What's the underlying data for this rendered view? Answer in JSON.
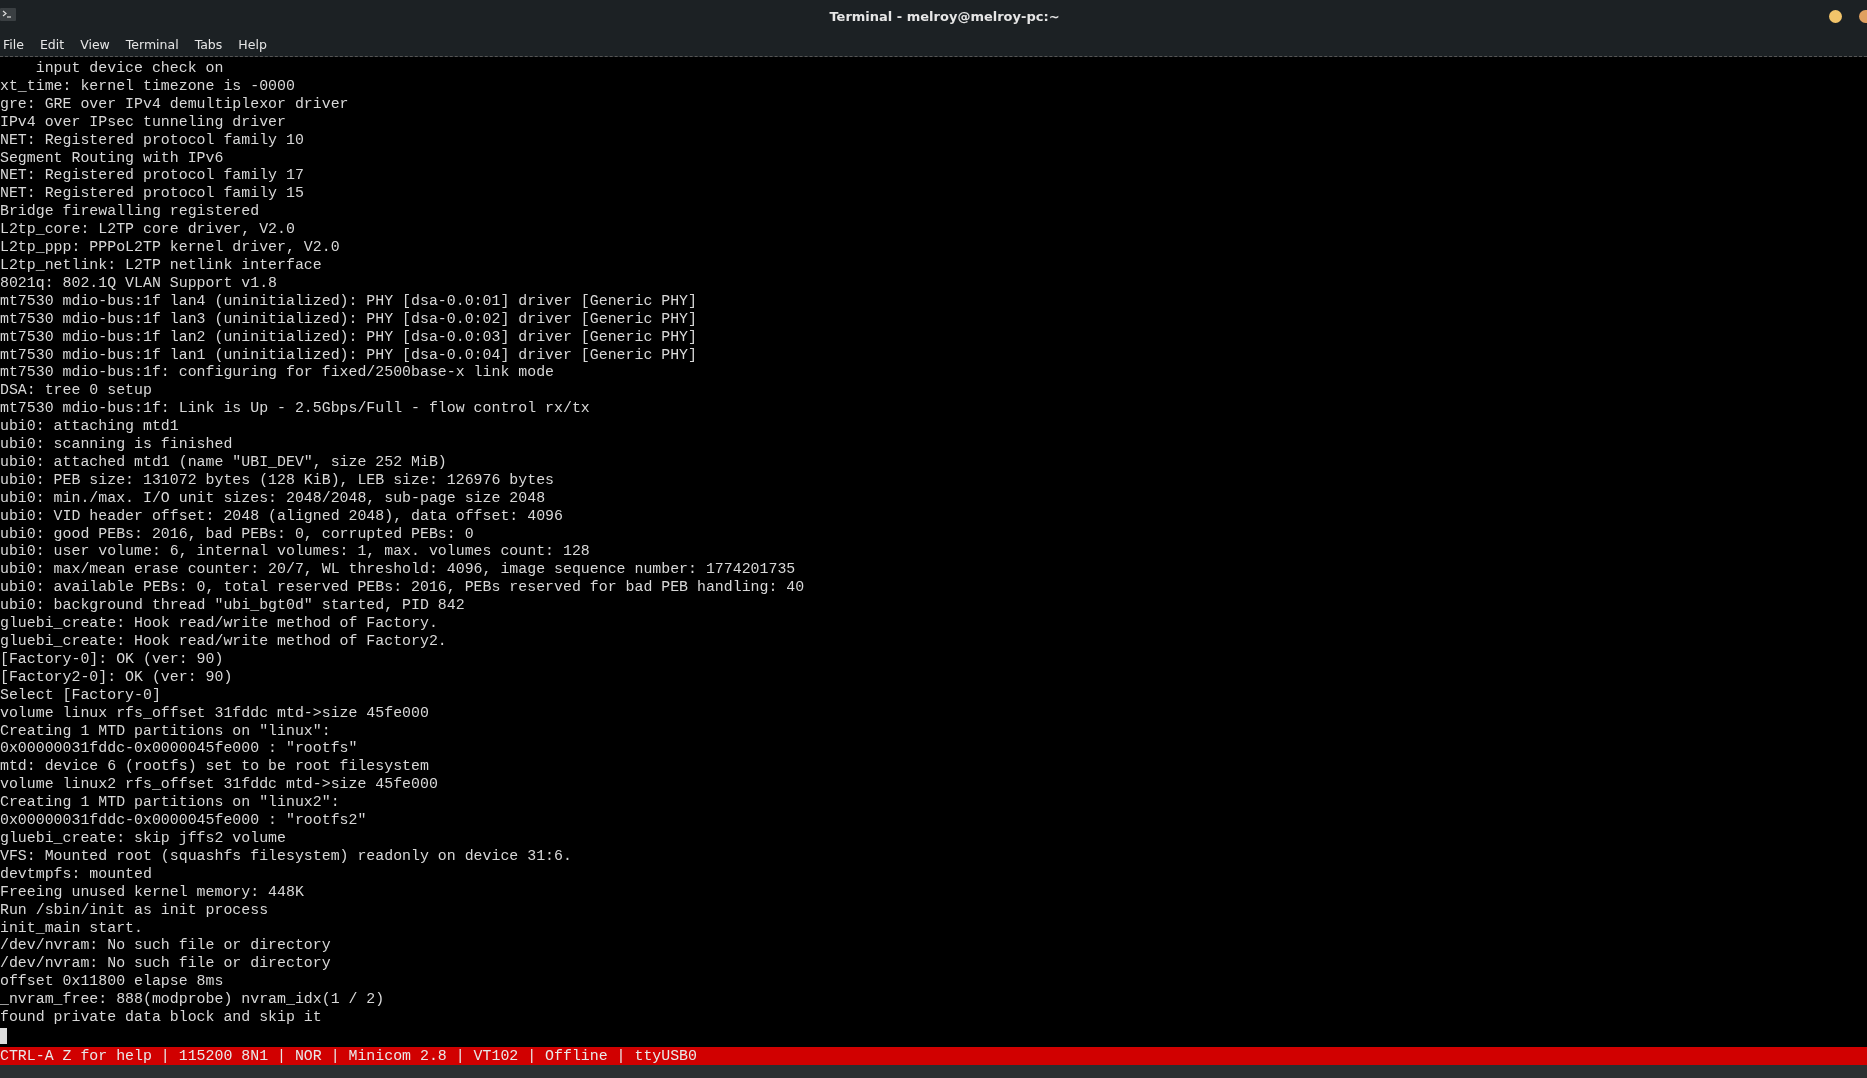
{
  "window": {
    "title": "Terminal - melroy@melroy-pc:~"
  },
  "menu": [
    "File",
    "Edit",
    "View",
    "Terminal",
    "Tabs",
    "Help"
  ],
  "terminal": {
    "lines": [
      "    input device check on",
      "xt_time: kernel timezone is -0000",
      "gre: GRE over IPv4 demultiplexor driver",
      "IPv4 over IPsec tunneling driver",
      "NET: Registered protocol family 10",
      "Segment Routing with IPv6",
      "NET: Registered protocol family 17",
      "NET: Registered protocol family 15",
      "Bridge firewalling registered",
      "L2tp_core: L2TP core driver, V2.0",
      "L2tp_ppp: PPPoL2TP kernel driver, V2.0",
      "L2tp_netlink: L2TP netlink interface",
      "8021q: 802.1Q VLAN Support v1.8",
      "mt7530 mdio-bus:1f lan4 (uninitialized): PHY [dsa-0.0:01] driver [Generic PHY]",
      "mt7530 mdio-bus:1f lan3 (uninitialized): PHY [dsa-0.0:02] driver [Generic PHY]",
      "mt7530 mdio-bus:1f lan2 (uninitialized): PHY [dsa-0.0:03] driver [Generic PHY]",
      "mt7530 mdio-bus:1f lan1 (uninitialized): PHY [dsa-0.0:04] driver [Generic PHY]",
      "mt7530 mdio-bus:1f: configuring for fixed/2500base-x link mode",
      "DSA: tree 0 setup",
      "mt7530 mdio-bus:1f: Link is Up - 2.5Gbps/Full - flow control rx/tx",
      "ubi0: attaching mtd1",
      "ubi0: scanning is finished",
      "ubi0: attached mtd1 (name \"UBI_DEV\", size 252 MiB)",
      "ubi0: PEB size: 131072 bytes (128 KiB), LEB size: 126976 bytes",
      "ubi0: min./max. I/O unit sizes: 2048/2048, sub-page size 2048",
      "ubi0: VID header offset: 2048 (aligned 2048), data offset: 4096",
      "ubi0: good PEBs: 2016, bad PEBs: 0, corrupted PEBs: 0",
      "ubi0: user volume: 6, internal volumes: 1, max. volumes count: 128",
      "ubi0: max/mean erase counter: 20/7, WL threshold: 4096, image sequence number: 1774201735",
      "ubi0: available PEBs: 0, total reserved PEBs: 2016, PEBs reserved for bad PEB handling: 40",
      "ubi0: background thread \"ubi_bgt0d\" started, PID 842",
      "gluebi_create: Hook read/write method of Factory.",
      "gluebi_create: Hook read/write method of Factory2.",
      "[Factory-0]: OK (ver: 90)",
      "[Factory2-0]: OK (ver: 90)",
      "Select [Factory-0]",
      "volume linux rfs_offset 31fddc mtd->size 45fe000",
      "Creating 1 MTD partitions on \"linux\":",
      "0x00000031fddc-0x0000045fe000 : \"rootfs\"",
      "mtd: device 6 (rootfs) set to be root filesystem",
      "volume linux2 rfs_offset 31fddc mtd->size 45fe000",
      "Creating 1 MTD partitions on \"linux2\":",
      "0x00000031fddc-0x0000045fe000 : \"rootfs2\"",
      "gluebi_create: skip jffs2 volume",
      "VFS: Mounted root (squashfs filesystem) readonly on device 31:6.",
      "devtmpfs: mounted",
      "Freeing unused kernel memory: 448K",
      "Run /sbin/init as init process",
      "init_main start.",
      "/dev/nvram: No such file or directory",
      "/dev/nvram: No such file or directory",
      "offset 0x11800 elapse 8ms",
      "_nvram_free: 888(modprobe) nvram_idx(1 / 2)",
      "found private data block and skip it"
    ]
  },
  "status_bar": "CTRL-A Z for help | 115200 8N1 | NOR | Minicom 2.8 | VT102 | Offline | ttyUSB0"
}
